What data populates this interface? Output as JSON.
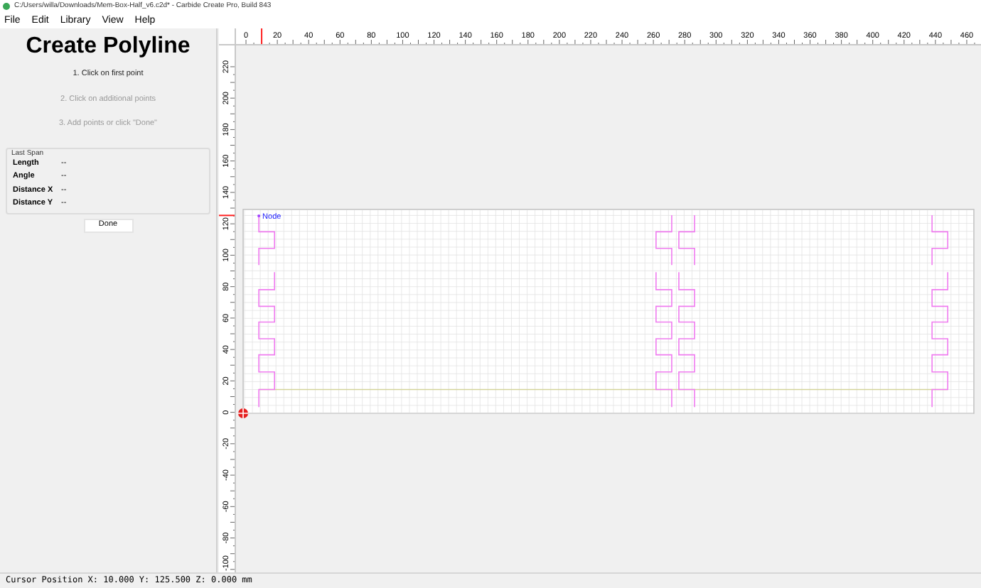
{
  "window": {
    "title": "C:/Users/willa/Downloads/Mem-Box-Half_v6.c2d* - Carbide Create Pro, Build 843"
  },
  "menu": [
    "File",
    "Edit",
    "Library",
    "View",
    "Help"
  ],
  "panel": {
    "title": "Create Polyline",
    "steps": [
      {
        "label": "1. Click on first point",
        "selected": true
      },
      {
        "label": "2. Click on additional points",
        "selected": false
      },
      {
        "label": "3. Add points or click \"Done\"",
        "selected": false
      }
    ],
    "group": {
      "title": "Last Span",
      "rows": [
        {
          "label": "Length",
          "value": "--"
        },
        {
          "label": "Angle",
          "value": "--"
        },
        {
          "label": "Distance X",
          "value": "--"
        },
        {
          "label": "Distance Y",
          "value": "--"
        }
      ]
    },
    "button": "Done"
  },
  "ruler_top": {
    "labels": [
      "0",
      "20",
      "40",
      "60",
      "80",
      "100",
      "120",
      "140",
      "160",
      "180",
      "200",
      "220",
      "240",
      "260",
      "280",
      "300",
      "320",
      "340",
      "360",
      "380",
      "400",
      "420",
      "440",
      "460"
    ]
  },
  "ruler_left": {
    "labels": [
      "220",
      "200",
      "180",
      "160",
      "140",
      "120",
      "100",
      "80",
      "60",
      "40",
      "20",
      "0",
      "-20",
      "-40",
      "-60",
      "-80",
      "-100"
    ]
  },
  "canvas": {
    "node_label": "Node"
  },
  "status_bar": "Cursor Position X: 10.000 Y: 125.500 Z: 0.000 mm"
}
